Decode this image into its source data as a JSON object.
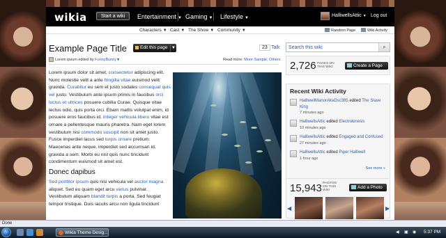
{
  "topbar": {
    "logo": "wikia",
    "start_wiki": "Start a wiki",
    "nav": [
      "Entertainment",
      "Gaming",
      "Lifestyle"
    ],
    "username": "HalliwellsAttic",
    "logout": "Log out"
  },
  "subnav": {
    "items": [
      "Characters",
      "Cast",
      "The Show",
      "Community"
    ],
    "random_page": "Random Page",
    "wiki_activity": "Wiki Activity"
  },
  "page": {
    "title": "Example Page Title",
    "edit_label": "Edit this page",
    "comment_count": "23",
    "talk": "Talk",
    "edited_by_prefix": "Lorem ipsum edited by",
    "edited_by_user": "FunnyBunny",
    "read_more_prefix": "Read more:",
    "read_more_link": "More Sample, Others"
  },
  "article": {
    "p1": [
      {
        "t": "Lorem ipsum dolor sit amet, "
      },
      {
        "t": "consectetur",
        "link": true
      },
      {
        "t": " adipiscing elit. Nunc molestie velit a ante "
      },
      {
        "t": "fringilla vitae",
        "link": true
      },
      {
        "t": " euismod velit gravida. "
      },
      {
        "t": "Curabitur",
        "link": true
      },
      {
        "t": " eu sem et justo sodales "
      },
      {
        "t": "consequat quis vel",
        "link": true
      },
      {
        "t": " justo. Vestibulum ante ipsum primis in faucibus "
      },
      {
        "t": "orci luctus et ultrices",
        "link": true
      },
      {
        "t": " posuere cubilia Curae. Quisque vitae lectus odio, quis porta orci. Ebam mattis volutpat enim, id posuere eros faucibus id. "
      },
      {
        "t": "Integer vehicula libero",
        "link": true
      },
      {
        "t": " vitae est ornare a pellentesque mauris pharetra. Nam eget lorem vestibulum nisi "
      },
      {
        "t": "commodo suscipit",
        "link": true
      },
      {
        "t": " non sit amet justo. Fusce imperdiet lacus sed "
      },
      {
        "t": "turpis",
        "link": true
      },
      {
        "t": " "
      },
      {
        "t": "ornare",
        "link": true
      },
      {
        "t": " pretium. Maecenas ante neque, imperdiet sed accumsan id, gravida a sem. Morbi eu nisl quis nunc tincidunt condimentum euismod sit amet est."
      }
    ],
    "h2": "Donec dapibus",
    "p2": [
      {
        "t": "Sed porttitor",
        "link": true
      },
      {
        "t": " "
      },
      {
        "t": "ipsum",
        "link": true
      },
      {
        "t": " quis nisi vehicula vel "
      },
      {
        "t": "auctor magna",
        "link": true
      },
      {
        "t": " aliquet. Sed eu quam eget arcu "
      },
      {
        "t": "varius",
        "link": true
      },
      {
        "t": " pulvinar. Vestibulum aliquam "
      },
      {
        "t": "blandit turpis",
        "link": true
      },
      {
        "t": " a porta. Sed feugiat tempor tristique. Duis iaculis arcu non ligula tincidunt"
      }
    ]
  },
  "rail": {
    "search_placeholder": "Search this wiki",
    "page_count": "2,726",
    "page_count_caption": [
      "PAGES ON",
      "THIS WIKI"
    ],
    "create_page": "Create a Page",
    "activity_title": "Recent Wiki Activity",
    "activity": [
      {
        "user": "HalliwellManorAkaDsc385",
        "action": "edited",
        "page": "The Slave King",
        "ago": "7 minutes ago"
      },
      {
        "user": "HalliwellsAttic",
        "action": "edited",
        "page": "Electrokinesis",
        "ago": "10 minutes ago"
      },
      {
        "user": "HalliwellsAttic",
        "action": "edited",
        "page": "Engaged and Confused",
        "ago": "27 minutes ago"
      },
      {
        "user": "HalliwellsAttic",
        "action": "edited",
        "page": "Piper Halliwell",
        "ago": "1 hour ago"
      }
    ],
    "see_more": "See more »",
    "photo_count": "15,943",
    "photo_count_caption": [
      "PHOTOS",
      "ON THIS",
      "WIKI"
    ],
    "add_photo": "Add a Photo"
  },
  "status": {
    "text": "Done"
  },
  "taskbar": {
    "window": "Wikia Theme Desig...",
    "clock": "5:37 PM"
  }
}
